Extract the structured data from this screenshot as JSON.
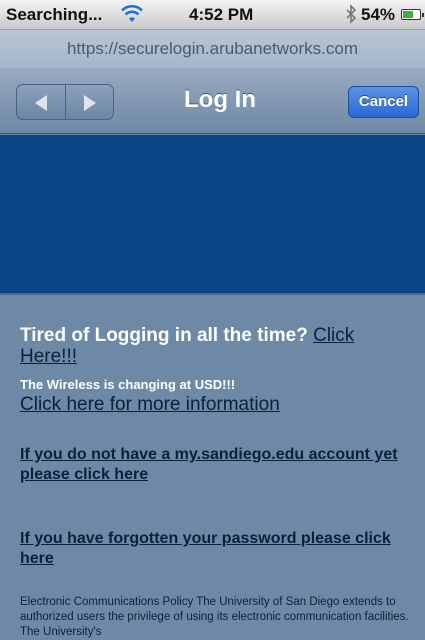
{
  "status_bar": {
    "carrier": "Searching...",
    "time": "4:52 PM",
    "battery_text": "54%",
    "battery_level": 0.54,
    "icons": [
      "wifi-icon",
      "bluetooth-icon",
      "battery-icon"
    ]
  },
  "url_bar": {
    "url": "https://securelogin.arubanetworks.com"
  },
  "nav_bar": {
    "title": "Log In",
    "cancel_label": "Cancel",
    "icons": [
      "back-arrow-icon",
      "forward-arrow-icon"
    ]
  },
  "content": {
    "tired_text": "Tired of Logging in all the time?",
    "tired_link": "Click Here!!!",
    "changing_text": "The Wireless is changing at USD!!!",
    "more_info_link": "Click here for more information",
    "account_link": "If you do not have a my.sandiego.edu account yet please click here",
    "password_link": "If you have forgotten your password please click here",
    "policy_text": "Electronic Communications Policy The University of San Diego extends to authorized users the privilege of using its electronic communication facilities. The University's"
  },
  "colors": {
    "banner": "#0b4487",
    "page_background": "#6d89a6",
    "cancel_button": "#2a68d3",
    "battery": "#3eb03e"
  }
}
